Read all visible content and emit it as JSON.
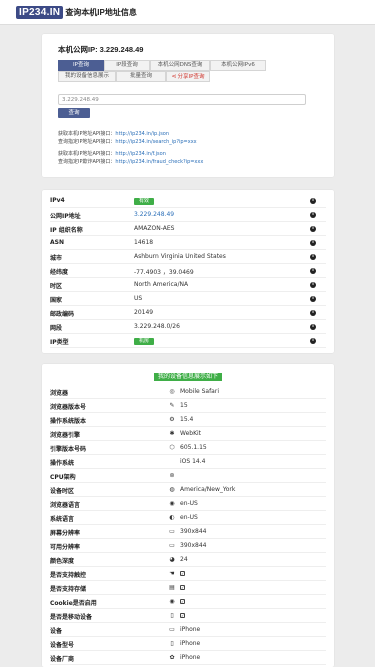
{
  "logo": {
    "main": "IP234.IN",
    "sub": "查询本机IP地址信息"
  },
  "my_ip_label": "本机公网IP: 3.229.248.49",
  "tabs": [
    {
      "label": "IP查询",
      "active": true
    },
    {
      "label": "IP段查询",
      "active": false
    },
    {
      "label": "本机公网DNS查询",
      "active": false
    },
    {
      "label": "本机公网IPv6",
      "active": false
    },
    {
      "label": "我的设备信息展示",
      "active": false
    },
    {
      "label": "批量查询",
      "active": false
    },
    {
      "label": "分享IP查询",
      "active": false,
      "red": true
    }
  ],
  "input": {
    "value": "3.229.248.49"
  },
  "button_label": "查询",
  "apis": [
    {
      "text": "获取本机IP地址API接口：",
      "link": "http://ip234.in/ip.json"
    },
    {
      "text": "查询指定IP地址API接口：",
      "link": "http://ip234.in/search_ip?ip=xxx"
    },
    {
      "text": "获取本机IP地址API接口：",
      "link": "http://ip234.in/f.json"
    },
    {
      "text": "查询指定IP欺诈API接口：",
      "link": "http://ip234.in/fraud_check?ip=xxx"
    }
  ],
  "ip_rows": [
    {
      "key": "IPv4",
      "value": "有效",
      "badge": true
    },
    {
      "key": "公网IP地址",
      "value": "3.229.248.49",
      "link": true
    },
    {
      "key": "IP 组织名称",
      "value": "AMAZON-AES"
    },
    {
      "key": "ASN",
      "value": "14618"
    },
    {
      "key": "城市",
      "value": "Ashburn Virginia United States"
    },
    {
      "key": "经纬度",
      "value": "-77.4903 ，39.0469"
    },
    {
      "key": "时区",
      "value": "North America/NA"
    },
    {
      "key": "国家",
      "value": "US"
    },
    {
      "key": "邮政编码",
      "value": "20149"
    },
    {
      "key": "网段",
      "value": "3.229.248.0/26"
    },
    {
      "key": "IP类型",
      "value": "机房",
      "badge": true
    }
  ],
  "device_heading": "我的设备信息展示如下",
  "device_rows": [
    {
      "key": "浏览器",
      "icon": "compass-icon",
      "glyph": "◎",
      "value": "Mobile Safari"
    },
    {
      "key": "浏览器版本号",
      "icon": "tag-icon",
      "glyph": "✎",
      "value": "15"
    },
    {
      "key": "操作系统版本",
      "icon": "gear-icon",
      "glyph": "⚙",
      "value": "15.4"
    },
    {
      "key": "浏览器引擎",
      "icon": "engine-icon",
      "glyph": "✱",
      "value": "WebKit"
    },
    {
      "key": "引擎版本号码",
      "icon": "cube-icon",
      "glyph": "⬡",
      "value": "605.1.15"
    },
    {
      "key": "操作系统",
      "icon": "apple-icon",
      "glyph": "",
      "value": "iOS 14.4"
    },
    {
      "key": "CPU架构",
      "icon": "cpu-icon",
      "glyph": "⊚",
      "value": ""
    },
    {
      "key": "设备时区",
      "icon": "globe-icon",
      "glyph": "◍",
      "value": "America/New_York"
    },
    {
      "key": "浏览器语言",
      "icon": "language-icon",
      "glyph": "◉",
      "value": "en-US"
    },
    {
      "key": "系统语言",
      "icon": "translate-icon",
      "glyph": "◐",
      "value": "en-US"
    },
    {
      "key": "屏幕分辨率",
      "icon": "monitor-icon",
      "glyph": "▭",
      "value": "390x844"
    },
    {
      "key": "可用分辨率",
      "icon": "monitor-icon",
      "glyph": "▭",
      "value": "390x844"
    },
    {
      "key": "颜色深度",
      "icon": "palette-icon",
      "glyph": "◕",
      "value": "24"
    },
    {
      "key": "是否支持触控",
      "icon": "touch-icon",
      "glyph": "☚",
      "value": "✓",
      "check": true
    },
    {
      "key": "是否支持存储",
      "icon": "storage-icon",
      "glyph": "▤",
      "value": "✓",
      "check": true
    },
    {
      "key": "Cookie是否启用",
      "icon": "eye-icon",
      "glyph": "◉",
      "value": "✓",
      "check": true
    },
    {
      "key": "是否是移动设备",
      "icon": "mobile-icon",
      "glyph": "▯",
      "value": "✓",
      "check": true
    },
    {
      "key": "设备",
      "icon": "laptop-icon",
      "glyph": "▭",
      "value": "iPhone"
    },
    {
      "key": "设备型号",
      "icon": "phone-icon",
      "glyph": "▯",
      "value": "iPhone"
    },
    {
      "key": "设备厂商",
      "icon": "factory-icon",
      "glyph": "✿",
      "value": "iPhone"
    }
  ]
}
